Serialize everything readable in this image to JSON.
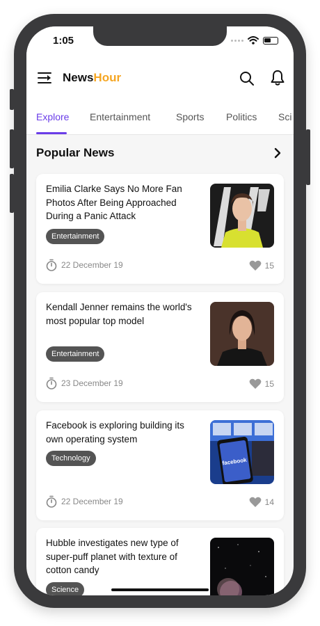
{
  "status_bar": {
    "time": "1:05"
  },
  "app": {
    "brand_part1": "News",
    "brand_part2": "Hour"
  },
  "tabs": [
    {
      "label": "Explore",
      "active": true
    },
    {
      "label": "Entertainment",
      "active": false
    },
    {
      "label": "Sports",
      "active": false
    },
    {
      "label": "Politics",
      "active": false
    },
    {
      "label": "Sci",
      "active": false
    }
  ],
  "section": {
    "title": "Popular News"
  },
  "articles": [
    {
      "title": "Emilia Clarke Says No More Fan Photos After Being Approached During a Panic Attack",
      "category": "Entertainment",
      "date": "22 December 19",
      "likes": "15",
      "image_icon": "person-photo"
    },
    {
      "title": "Kendall Jenner remains the world's most popular top model",
      "category": "Entertainment",
      "date": "23 December 19",
      "likes": "15",
      "image_icon": "person-photo"
    },
    {
      "title": "Facebook is exploring building its own operating system",
      "category": "Technology",
      "date": "22 December 19",
      "likes": "14",
      "image_icon": "facebook-phone-photo",
      "image_text": "facebook"
    },
    {
      "title": "Hubble investigates new type of super-puff planet with texture of cotton candy",
      "category": "Science",
      "date": "",
      "likes": "",
      "image_icon": "planet-photo"
    }
  ],
  "colors": {
    "accent": "#6a3de8",
    "brand_orange": "#f5a623",
    "tag_bg": "#545454"
  }
}
